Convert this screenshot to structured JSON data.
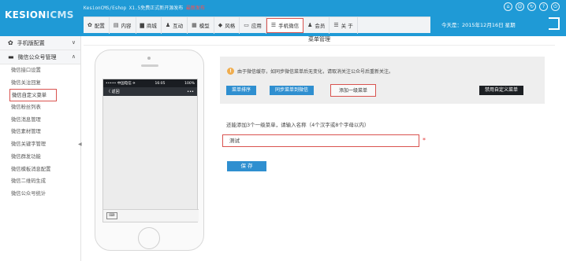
{
  "app": {
    "logo_main": "KESION",
    "logo_sub": "ICMS",
    "news_text": "KesionCMS/Eshop X1.5免费正式新开源发布",
    "news_highlight": "最新发布",
    "date_label": "今天是：2015年12月16日 星期",
    "top_icons": [
      "home-icon",
      "user-icon",
      "refresh-icon",
      "help-icon",
      "power-icon"
    ]
  },
  "nav": {
    "items": [
      {
        "label": "配置",
        "icon": "gear-icon"
      },
      {
        "label": "内容",
        "icon": "document-icon"
      },
      {
        "label": "商城",
        "icon": "shop-icon"
      },
      {
        "label": "互动",
        "icon": "people-icon"
      },
      {
        "label": "模型",
        "icon": "grid-icon"
      },
      {
        "label": "风格",
        "icon": "tag-icon"
      },
      {
        "label": "应用",
        "icon": "monitor-icon"
      },
      {
        "label": "手机微信",
        "icon": "menu-icon"
      },
      {
        "label": "会员",
        "icon": "user-icon"
      },
      {
        "label": "关 于",
        "icon": "menu-icon"
      }
    ]
  },
  "sidebar": {
    "group1": "手机版配置",
    "group2": "微信公众号管理",
    "items": [
      "微信接口设置",
      "微信关注回复",
      "微信自定义菜单",
      "微信粉丝列表",
      "微信消息管理",
      "微信素材管理",
      "微信关键字管理",
      "微信群发功能",
      "微信模板消息配置",
      "微信二维码生成",
      "微信公众号统计"
    ]
  },
  "main": {
    "page_title": "菜单管理",
    "notice": "由于微信缓存，如同步微信菜单后无变化，请取消关注公众号后重新关注。",
    "btn_sort": "菜单排序",
    "btn_sync": "同步菜单到微信",
    "btn_add": "添加一级菜单",
    "btn_disable": "禁用自定义菜单",
    "hint": "还能添加3个一级菜单，请输入名称（4个汉字或8个字母以内）",
    "input_value": "测试",
    "required_mark": "*",
    "save_label": "保 存"
  },
  "phone": {
    "status_left": "••••• 中国电信 ✈",
    "status_time": "16:05",
    "status_right": "100%",
    "back_label": "〈 返回",
    "more": "•••"
  },
  "colors": {
    "header": "#1f9ad6",
    "primary_button": "#2f8fd0",
    "highlight_border": "#d9534f",
    "dark_button": "#1c1f23"
  }
}
